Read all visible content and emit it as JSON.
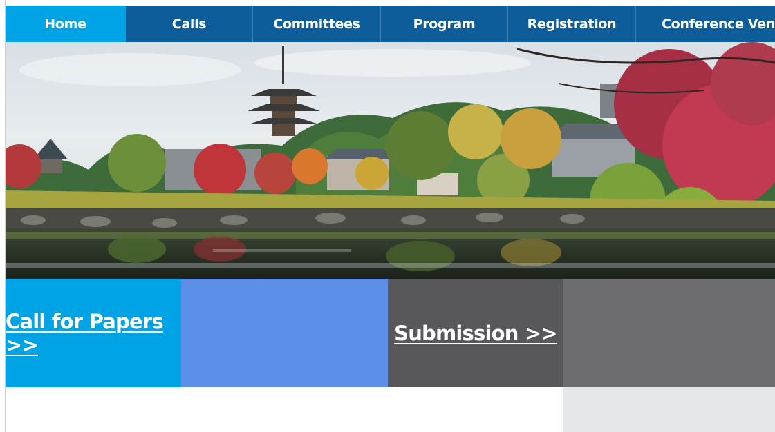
{
  "nav": {
    "items": [
      {
        "label": "Home",
        "active": true
      },
      {
        "label": "Calls"
      },
      {
        "label": "Committees"
      },
      {
        "label": "Program"
      },
      {
        "label": "Registration"
      },
      {
        "label": "Conference Venue"
      }
    ]
  },
  "tiles": {
    "call_for_papers": "Call for Papers >>",
    "submission": "Submission >>"
  },
  "colors": {
    "nav_bg": "#0c5d9a",
    "nav_active": "#00a3e3",
    "tile_cyan": "#00a3e3",
    "tile_blue": "#5b8fe8",
    "tile_dark_gray": "#58585a",
    "tile_gray": "#6d6d70"
  }
}
